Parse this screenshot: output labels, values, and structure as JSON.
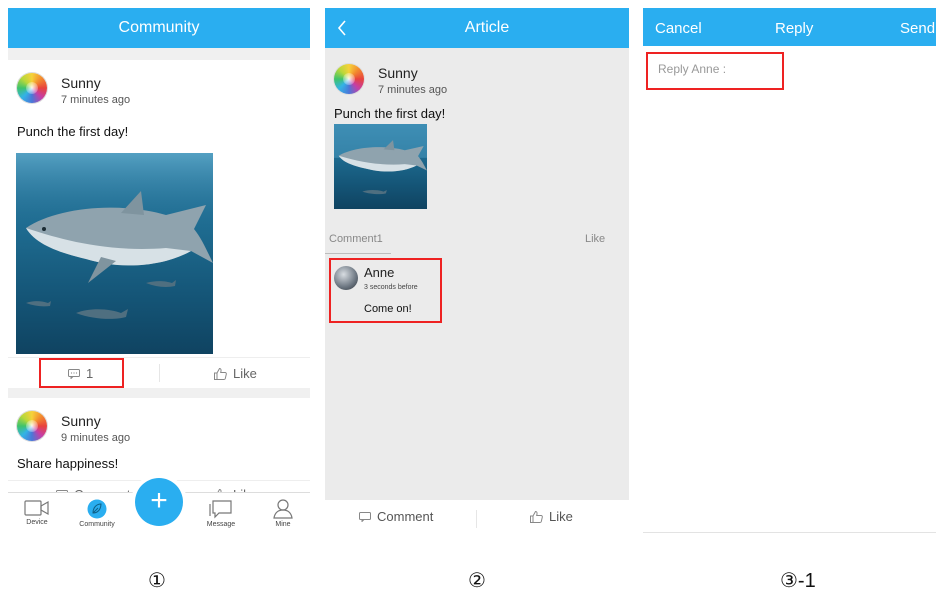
{
  "screen1": {
    "title": "Community",
    "posts": [
      {
        "user": "Sunny",
        "time": "7 minutes ago",
        "text": "Punch the first day!",
        "comment_count": "1",
        "like_label": "Like"
      },
      {
        "user": "Sunny",
        "time": "9 minutes ago",
        "text": "Share happiness!",
        "comment_label": "Comment",
        "like_label": "Like"
      }
    ],
    "tabs": [
      {
        "label": "Device",
        "icon": "video-camera-icon"
      },
      {
        "label": "Community",
        "icon": "leaf-icon"
      },
      {
        "label": "Message",
        "icon": "chat-bubble-icon"
      },
      {
        "label": "Mine",
        "icon": "person-icon"
      }
    ],
    "fab_label": "+"
  },
  "screen2": {
    "title": "Article",
    "post": {
      "user": "Sunny",
      "time": "7 minutes ago",
      "text": "Punch the first day!"
    },
    "comments_header": "Comment1",
    "like_header": "Like",
    "comment": {
      "user": "Anne",
      "time": "3 seconds before",
      "text": "Come on!"
    },
    "bottom": {
      "comment_label": "Comment",
      "like_label": "Like"
    }
  },
  "screen3": {
    "cancel_label": "Cancel",
    "title": "Reply",
    "send_label": "Send",
    "placeholder": "Reply Anne :"
  },
  "captions": [
    "①",
    "②",
    "③-1"
  ],
  "colors": {
    "accent": "#2aaef0",
    "highlight": "#e22222"
  }
}
